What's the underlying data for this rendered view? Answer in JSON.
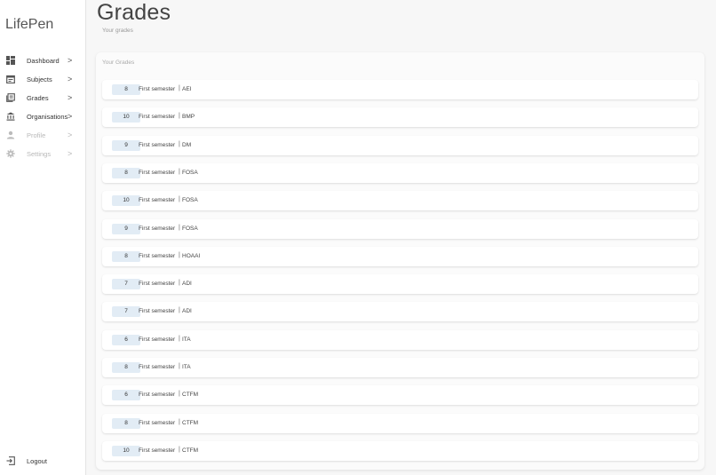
{
  "app": {
    "brand": "LifePen"
  },
  "sidebar": {
    "items": [
      {
        "label": "Dashboard",
        "icon": "dashboard-icon",
        "chevron": ">",
        "disabled": false
      },
      {
        "label": "Subjects",
        "icon": "calendar-icon",
        "chevron": ">",
        "disabled": false
      },
      {
        "label": "Grades",
        "icon": "grades-icon",
        "chevron": ">",
        "disabled": false
      },
      {
        "label": "Organisations",
        "icon": "bank-icon",
        "chevron": ">",
        "disabled": false
      },
      {
        "label": "Profile",
        "icon": "person-icon",
        "chevron": ">",
        "disabled": true
      },
      {
        "label": "Settings",
        "icon": "gear-icon",
        "chevron": ">",
        "disabled": true
      }
    ],
    "logout": {
      "label": "Logout",
      "icon": "logout-icon"
    }
  },
  "page": {
    "title": "Grades",
    "subtitle": "Your grades"
  },
  "grades_card": {
    "title": "Your Grades",
    "separator": "|",
    "rows": [
      {
        "grade": "8",
        "semester": "First semester",
        "subject": "AEI"
      },
      {
        "grade": "10",
        "semester": "First semester",
        "subject": "BMP"
      },
      {
        "grade": "9",
        "semester": "First semester",
        "subject": "DM"
      },
      {
        "grade": "8",
        "semester": "First semester",
        "subject": "FOSA"
      },
      {
        "grade": "10",
        "semester": "First semester",
        "subject": "FOSA"
      },
      {
        "grade": "9",
        "semester": "First semester",
        "subject": "FOSA"
      },
      {
        "grade": "8",
        "semester": "First semester",
        "subject": "HOAAI"
      },
      {
        "grade": "7",
        "semester": "First semester",
        "subject": "ADI"
      },
      {
        "grade": "7",
        "semester": "First semester",
        "subject": "ADI"
      },
      {
        "grade": "6",
        "semester": "First semester",
        "subject": "ITA"
      },
      {
        "grade": "8",
        "semester": "First semester",
        "subject": "ITA"
      },
      {
        "grade": "6",
        "semester": "First semester",
        "subject": "CTFM"
      },
      {
        "grade": "8",
        "semester": "First semester",
        "subject": "CTFM"
      },
      {
        "grade": "10",
        "semester": "First semester",
        "subject": "CTFM"
      }
    ]
  },
  "colors": {
    "badge_bg": "#e2ecf5",
    "disabled_text": "#b8b8b8",
    "page_bg": "#f7f7f7"
  }
}
